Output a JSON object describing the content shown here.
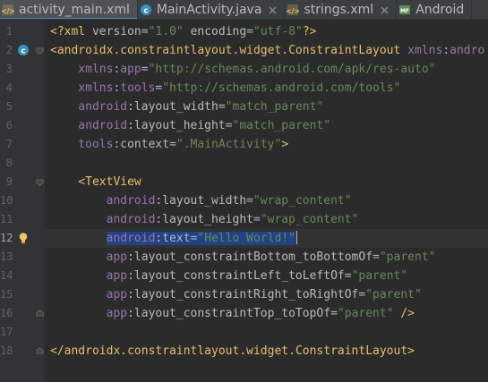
{
  "tabs": [
    {
      "label": "activity_main.xml",
      "icon": "xml-file-icon",
      "active": true
    },
    {
      "label": "MainActivity.java",
      "icon": "java-class-icon",
      "active": false
    },
    {
      "label": "strings.xml",
      "icon": "xml-file-icon",
      "active": false
    },
    {
      "label": "Android",
      "icon": "manifest-file-icon",
      "active": false
    }
  ],
  "colors": {
    "background": "#2b2b2b",
    "gutter": "#313335",
    "selection": "#214283",
    "tag": "#e8bf6a",
    "namespace": "#9876aa",
    "attribute": "#bababa",
    "string": "#6a8759"
  },
  "editor": {
    "caret_line": 12,
    "lines": [
      {
        "n": "1",
        "segs": [
          {
            "t": "<?xml ",
            "c": "pi"
          },
          {
            "t": "version",
            "c": "attr"
          },
          {
            "t": "=",
            "c": "plain"
          },
          {
            "t": "\"1.0\"",
            "c": "str"
          },
          {
            "t": " ",
            "c": "plain"
          },
          {
            "t": "encoding",
            "c": "attr"
          },
          {
            "t": "=",
            "c": "plain"
          },
          {
            "t": "\"utf-8\"",
            "c": "str"
          },
          {
            "t": "?>",
            "c": "pi"
          }
        ]
      },
      {
        "n": "2",
        "segs": [
          {
            "t": "<androidx.constraintlayout.widget.ConstraintLayout ",
            "c": "tag"
          },
          {
            "t": "xmlns",
            "c": "ns"
          },
          {
            "t": ":",
            "c": "plain"
          },
          {
            "t": "andro",
            "c": "ns"
          }
        ]
      },
      {
        "n": "3",
        "segs": [
          {
            "t": "    xmlns",
            "c": "ns"
          },
          {
            "t": ":",
            "c": "plain"
          },
          {
            "t": "app",
            "c": "ns"
          },
          {
            "t": "=",
            "c": "plain"
          },
          {
            "t": "\"http://schemas.android.com/apk/res-auto\"",
            "c": "str"
          }
        ]
      },
      {
        "n": "4",
        "segs": [
          {
            "t": "    xmlns",
            "c": "ns"
          },
          {
            "t": ":",
            "c": "plain"
          },
          {
            "t": "tools",
            "c": "ns"
          },
          {
            "t": "=",
            "c": "plain"
          },
          {
            "t": "\"http://schemas.android.com/tools\"",
            "c": "str"
          }
        ]
      },
      {
        "n": "5",
        "segs": [
          {
            "t": "    android",
            "c": "ns"
          },
          {
            "t": ":layout_width",
            "c": "attr"
          },
          {
            "t": "=",
            "c": "plain"
          },
          {
            "t": "\"match_parent\"",
            "c": "str"
          }
        ]
      },
      {
        "n": "6",
        "segs": [
          {
            "t": "    android",
            "c": "ns"
          },
          {
            "t": ":layout_height",
            "c": "attr"
          },
          {
            "t": "=",
            "c": "plain"
          },
          {
            "t": "\"match_parent\"",
            "c": "str"
          }
        ]
      },
      {
        "n": "7",
        "segs": [
          {
            "t": "    tools",
            "c": "ns"
          },
          {
            "t": ":context",
            "c": "attr"
          },
          {
            "t": "=",
            "c": "plain"
          },
          {
            "t": "\".MainActivity\"",
            "c": "str"
          },
          {
            "t": ">",
            "c": "tag"
          }
        ]
      },
      {
        "n": "8",
        "segs": []
      },
      {
        "n": "9",
        "segs": [
          {
            "t": "    <TextView",
            "c": "tag"
          }
        ]
      },
      {
        "n": "10",
        "segs": [
          {
            "t": "        android",
            "c": "ns"
          },
          {
            "t": ":layout_width",
            "c": "attr"
          },
          {
            "t": "=",
            "c": "plain"
          },
          {
            "t": "\"wrap_content\"",
            "c": "str"
          }
        ]
      },
      {
        "n": "11",
        "segs": [
          {
            "t": "        android",
            "c": "ns"
          },
          {
            "t": ":layout_height",
            "c": "attr"
          },
          {
            "t": "=",
            "c": "plain"
          },
          {
            "t": "\"wrap_content\"",
            "c": "str"
          }
        ]
      },
      {
        "n": "12",
        "segs": [
          {
            "t": "        ",
            "c": "plain"
          },
          {
            "t": "android",
            "c": "ns",
            "sel": true
          },
          {
            "t": ":text",
            "c": "attr",
            "sel": true
          },
          {
            "t": "=",
            "c": "plain",
            "sel": true
          },
          {
            "t": "\"Hello World!\"",
            "c": "str",
            "sel": true
          }
        ]
      },
      {
        "n": "13",
        "segs": [
          {
            "t": "        app",
            "c": "ns"
          },
          {
            "t": ":layout_constraintBottom_toBottomOf",
            "c": "attr"
          },
          {
            "t": "=",
            "c": "plain"
          },
          {
            "t": "\"parent\"",
            "c": "str"
          }
        ]
      },
      {
        "n": "14",
        "segs": [
          {
            "t": "        app",
            "c": "ns"
          },
          {
            "t": ":layout_constraintLeft_toLeftOf",
            "c": "attr"
          },
          {
            "t": "=",
            "c": "plain"
          },
          {
            "t": "\"parent\"",
            "c": "str"
          }
        ]
      },
      {
        "n": "15",
        "segs": [
          {
            "t": "        app",
            "c": "ns"
          },
          {
            "t": ":layout_constraintRight_toRightOf",
            "c": "attr"
          },
          {
            "t": "=",
            "c": "plain"
          },
          {
            "t": "\"parent\"",
            "c": "str"
          }
        ]
      },
      {
        "n": "16",
        "segs": [
          {
            "t": "        app",
            "c": "ns"
          },
          {
            "t": ":layout_constraintTop_toTopOf",
            "c": "attr"
          },
          {
            "t": "=",
            "c": "plain"
          },
          {
            "t": "\"parent\"",
            "c": "str"
          },
          {
            "t": " />",
            "c": "tag"
          }
        ]
      },
      {
        "n": "17",
        "segs": []
      },
      {
        "n": "18",
        "segs": [
          {
            "t": "</androidx.constraintlayout.widget.ConstraintLayout>",
            "c": "tag"
          }
        ]
      }
    ]
  }
}
